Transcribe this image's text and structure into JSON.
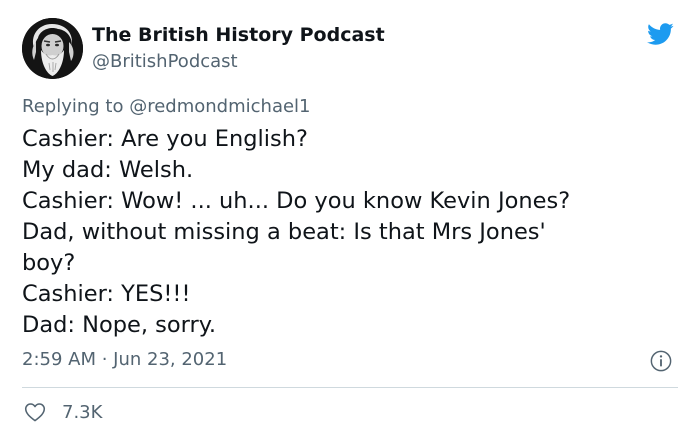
{
  "tweet": {
    "author": {
      "name": "The British History Podcast",
      "handle": "@BritishPodcast",
      "avatar_icon": "bearded-man-portrait"
    },
    "platform_icon": "twitter-bird-icon",
    "reply": {
      "prefix": "Replying to",
      "mention": "@redmondmichael1"
    },
    "body_lines": [
      "Cashier: Are you English?",
      "My dad: Welsh.",
      "Cashier: Wow! ... uh... Do you know Kevin Jones?",
      "Dad, without missing a beat: Is that Mrs Jones'",
      "boy?",
      "Cashier: YES!!!",
      "Dad: Nope, sorry."
    ],
    "timestamp": "2:59 AM · Jun 23, 2021",
    "info_icon": "info-circle-icon",
    "likes": {
      "icon": "heart-outline-icon",
      "count": "7.3K"
    }
  },
  "colors": {
    "twitter_blue": "#1d9bf0",
    "text_primary": "#0f1419",
    "text_secondary": "#536471",
    "divider": "#cfd9de"
  }
}
